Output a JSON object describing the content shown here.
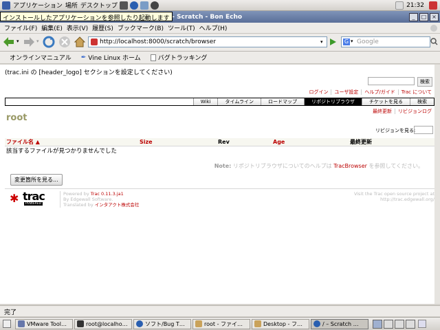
{
  "gnome_panel": {
    "menus": [
      "アプリケーション",
      "場所",
      "デスクトップ"
    ],
    "clock": "21:32"
  },
  "window": {
    "title": "/ – Scratch - Bon Echo",
    "tooltip": "インストールしたアプリケーションを参照したり起動します"
  },
  "menubar": [
    "ファイル(F)",
    "編集(E)",
    "表示(V)",
    "履歴(S)",
    "ブックマーク(B)",
    "ツール(T)",
    "ヘルプ(H)"
  ],
  "nav": {
    "url": "http://localhost:8000/scratch/browser",
    "search_placeholder": "Google"
  },
  "bookmarks": [
    "オンラインマニュアル",
    "Vine Linux ホーム",
    "バグトラッキング"
  ],
  "trac": {
    "header_logo": "(trac.ini の [header_logo] セクションを設定してください)",
    "search_button": "検索",
    "metanav": [
      "ログイン",
      "ユーザ設定",
      "ヘルプ/ガイド",
      "Trac について"
    ],
    "mainnav": [
      "Wiki",
      "タイムライン",
      "ロードマップ",
      "リポジトリブラウザ",
      "チケットを見る",
      "検索"
    ],
    "mainnav_active": "リポジトリブラウザ",
    "ctxtnav": [
      "最終更新",
      "リビジョンログ"
    ],
    "path": "root",
    "rev_label": "リビジョンを見る:",
    "columns": [
      "ファイル名 ▲",
      "Size",
      "Rev",
      "Age",
      "最終更新"
    ],
    "empty_message": "該当するファイルが見つかりませんでした",
    "note_label": "Note:",
    "note_text": " リポジトリブラウザについてのヘルプは ",
    "note_link": "TracBrowser",
    "note_suffix": " を参照してください。",
    "changes_button": "変更箇所を見る...",
    "logo_text": "trac",
    "logo_sub": "POWERED",
    "powered_1": "Powered by ",
    "powered_link": "Trac 0.11.3.ja1",
    "powered_2": "By Edgewall Software.",
    "powered_3": "Translated by ",
    "powered_link2": "インタアクト株式会社",
    "visit_1": "Visit the Trac open source project at",
    "visit_link": "http://trac.edgewall.org/"
  },
  "status": "完了",
  "taskbar": [
    "VMware Tool…",
    "root@localho…",
    "ソフト/Bug T…",
    "root - ファイ…",
    "Desktop - フ…",
    "/ – Scratch …"
  ],
  "colors": {
    "titlebar": "#5a6f99",
    "trac_link": "#bb0000",
    "path_title": "#999966"
  }
}
